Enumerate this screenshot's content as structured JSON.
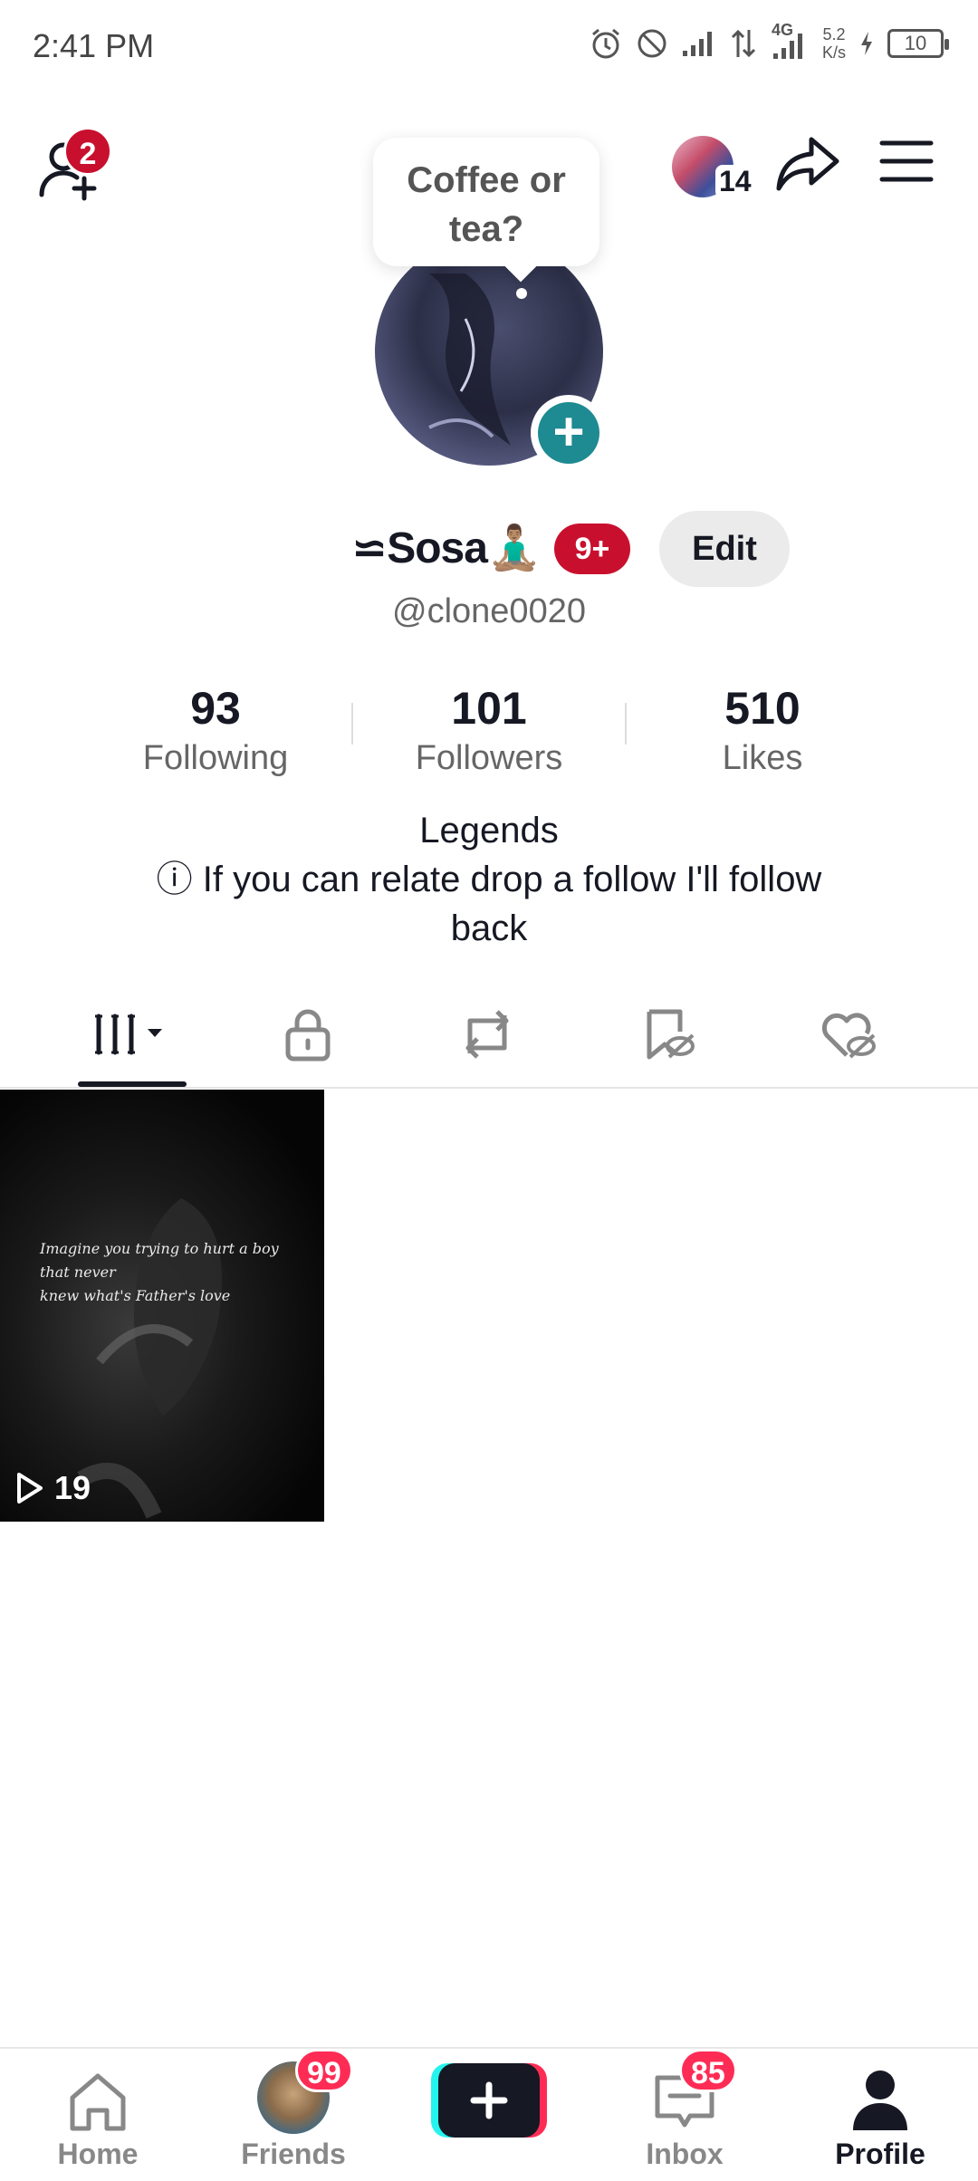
{
  "status_bar": {
    "time": "2:41 PM",
    "network": "4G",
    "speed_value": "5.2",
    "speed_unit": "K/s",
    "battery": "10",
    "icons": [
      "alarm-icon",
      "do-not-disturb-icon",
      "signal-icon",
      "data-arrows-icon",
      "signal-4g-icon",
      "charging-icon",
      "battery-icon"
    ]
  },
  "header": {
    "add_friend_badge": "2",
    "visitor_count": "14",
    "icons": [
      "add-friend-icon",
      "share-icon",
      "menu-icon"
    ]
  },
  "note_bubble": {
    "line1": "Coffee or",
    "line2": "tea?"
  },
  "profile": {
    "display_name": "⋍Sosa🧘🏽‍♂️",
    "name_badge": "9+",
    "edit_label": "Edit",
    "username": "@clone0020"
  },
  "stats": [
    {
      "value": "93",
      "label": "Following"
    },
    {
      "value": "101",
      "label": "Followers"
    },
    {
      "value": "510",
      "label": "Likes"
    }
  ],
  "bio": {
    "line1": "Legends",
    "line2": "ⓘ If you can relate drop a follow I'll follow",
    "line3": "back"
  },
  "tabs": [
    {
      "name": "videos",
      "icon": "grid-lines-icon",
      "active": true
    },
    {
      "name": "private",
      "icon": "lock-icon"
    },
    {
      "name": "reposts",
      "icon": "repost-icon"
    },
    {
      "name": "favorites",
      "icon": "bookmark-hidden-icon"
    },
    {
      "name": "liked",
      "icon": "heart-hidden-icon"
    }
  ],
  "videos": [
    {
      "caption_line1": "Imagine you trying to hurt a boy that never",
      "caption_line2": "knew what's Father's love",
      "views": "19"
    }
  ],
  "bottom_nav": {
    "home": "Home",
    "friends": "Friends",
    "friends_badge": "99",
    "inbox": "Inbox",
    "inbox_badge": "85",
    "profile": "Profile"
  },
  "colors": {
    "badge_red": "#c8102e",
    "nav_badge": "#fe2c55",
    "teal_plus": "#1e8a92",
    "text_primary": "#161823",
    "text_secondary": "#666666"
  }
}
